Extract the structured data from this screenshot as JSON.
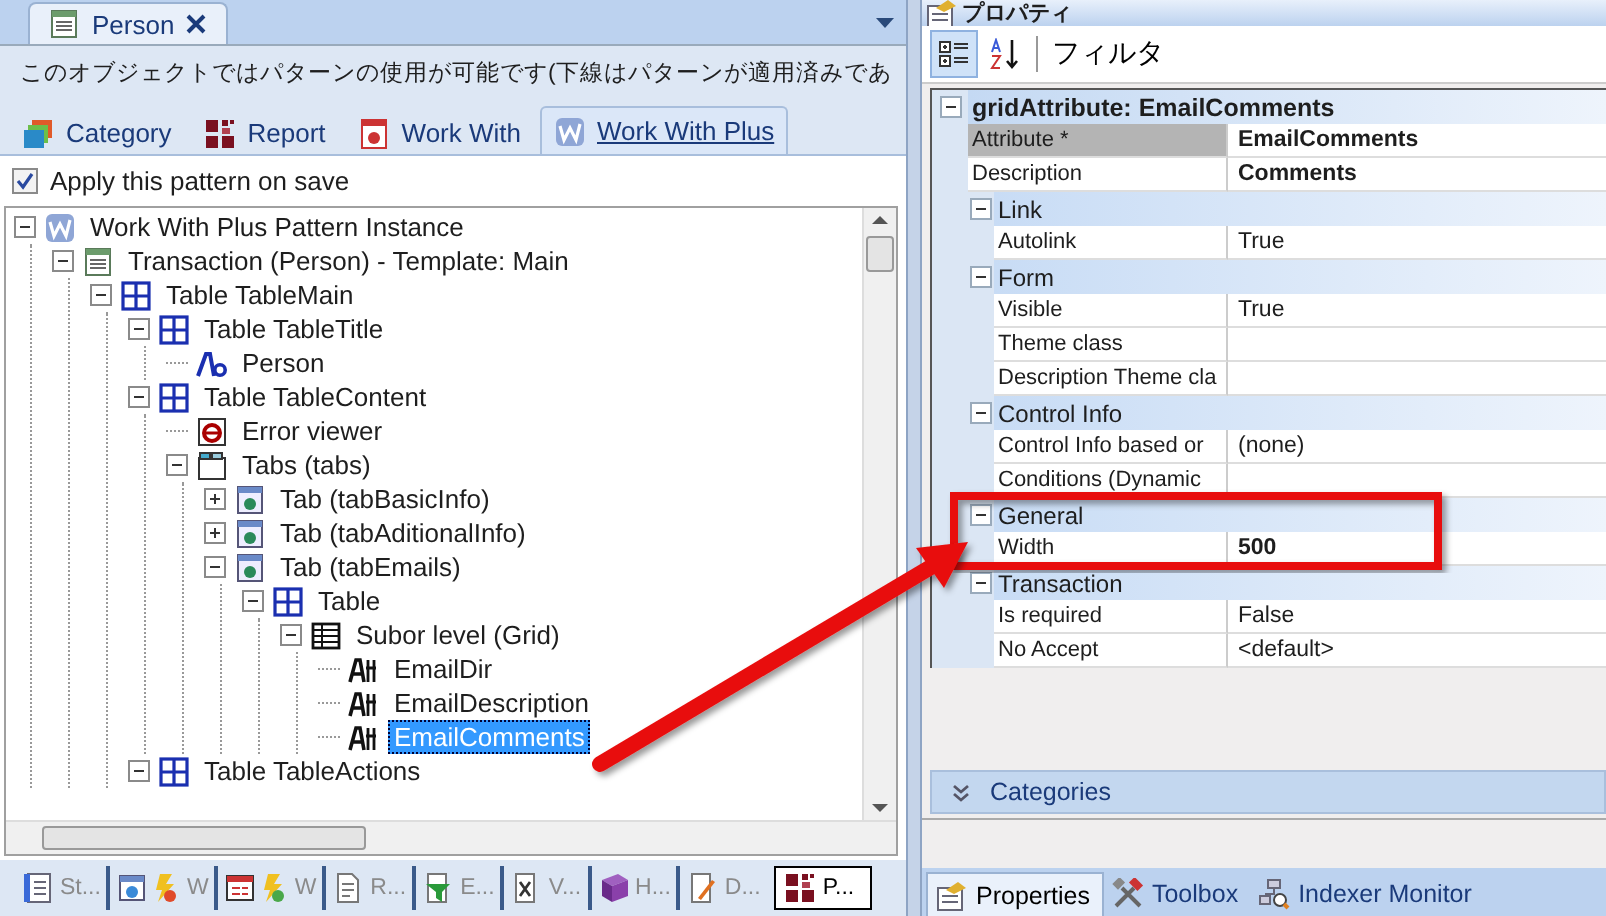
{
  "document_tab": {
    "title": "Person",
    "selected": true
  },
  "notice": "このオブジェクトではパターンの使用が可能です(下線はパターンが適用済みであ",
  "pattern_tabs": [
    {
      "label": "Category",
      "kind": "category",
      "selected": false
    },
    {
      "label": "Report",
      "kind": "report",
      "selected": false
    },
    {
      "label": "Work With",
      "kind": "workwith",
      "selected": false
    },
    {
      "label": "Work With Plus",
      "kind": "workwithplus",
      "selected": true
    }
  ],
  "apply_on_save": {
    "label": "Apply this pattern on save",
    "checked": true
  },
  "tree": [
    {
      "label": "Work With Plus Pattern Instance",
      "kind": "pattern",
      "expanded": true,
      "selected": false,
      "children": [
        {
          "label": "Transaction (Person) - Template: Main",
          "kind": "transaction",
          "expanded": true,
          "selected": false,
          "children": [
            {
              "label": "Table TableMain",
              "kind": "table",
              "expanded": true,
              "selected": false,
              "children": [
                {
                  "label": "Table TableTitle",
                  "kind": "table",
                  "expanded": true,
                  "selected": false,
                  "children": [
                    {
                      "label": "Person",
                      "kind": "textblock",
                      "selected": false
                    }
                  ]
                },
                {
                  "label": "Table TableContent",
                  "kind": "table",
                  "expanded": true,
                  "selected": false,
                  "children": [
                    {
                      "label": "Error viewer",
                      "kind": "error",
                      "selected": false
                    },
                    {
                      "label": "Tabs (tabs)",
                      "kind": "tabs",
                      "expanded": true,
                      "selected": false,
                      "children": [
                        {
                          "label": "Tab (tabBasicInfo)",
                          "kind": "tab",
                          "expanded": false,
                          "selected": false
                        },
                        {
                          "label": "Tab (tabAditionalInfo)",
                          "kind": "tab",
                          "expanded": false,
                          "selected": false
                        },
                        {
                          "label": "Tab (tabEmails)",
                          "kind": "tab",
                          "expanded": true,
                          "selected": false,
                          "children": [
                            {
                              "label": "Table",
                              "kind": "table",
                              "expanded": true,
                              "selected": false,
                              "children": [
                                {
                                  "label": "Subor level (Grid)",
                                  "kind": "grid",
                                  "expanded": true,
                                  "selected": false,
                                  "children": [
                                    {
                                      "label": "EmailDir",
                                      "kind": "attribute",
                                      "selected": false
                                    },
                                    {
                                      "label": "EmailDescription",
                                      "kind": "attribute",
                                      "selected": false
                                    },
                                    {
                                      "label": "EmailComments",
                                      "kind": "attribute",
                                      "selected": true
                                    }
                                  ]
                                }
                              ]
                            }
                          ]
                        }
                      ]
                    }
                  ]
                },
                {
                  "label": "Table TableActions",
                  "kind": "table",
                  "expanded": true,
                  "selected": false
                }
              ]
            }
          ]
        }
      ]
    }
  ],
  "tool_tabs": [
    {
      "label": "St...",
      "kind": "structure",
      "selected": false
    },
    {
      "label": "W",
      "kind": "webform",
      "selected": false
    },
    {
      "label": "W",
      "kind": "winform",
      "selected": false
    },
    {
      "label": "R...",
      "kind": "rules",
      "selected": false
    },
    {
      "label": "E...",
      "kind": "events",
      "selected": false
    },
    {
      "label": "V...",
      "kind": "variables",
      "selected": false
    },
    {
      "label": "H...",
      "kind": "help",
      "selected": false
    },
    {
      "label": "D...",
      "kind": "documentation",
      "selected": false
    },
    {
      "label": "P...",
      "kind": "patterns",
      "selected": true
    }
  ],
  "properties": {
    "title": "プロパティ",
    "view_buttons": [
      {
        "kind": "categorized",
        "selected": true
      },
      {
        "kind": "alphabetical",
        "selected": false
      }
    ],
    "filter_label": "フィルタ",
    "grid": {
      "title": "gridAttribute: EmailComments",
      "expanded": true,
      "rows": [
        {
          "kind": "property",
          "name": "Attribute *",
          "value": "EmailComments",
          "bold": true,
          "selected": true
        },
        {
          "kind": "property",
          "name": "Description",
          "value": "Comments",
          "bold": true,
          "selected": false
        },
        {
          "kind": "group",
          "label": "Link",
          "expanded": true
        },
        {
          "kind": "property",
          "name": "Autolink",
          "value": "True",
          "bold": false,
          "selected": false
        },
        {
          "kind": "group",
          "label": "Form",
          "expanded": true
        },
        {
          "kind": "property",
          "name": "Visible",
          "value": "True",
          "bold": false,
          "selected": false
        },
        {
          "kind": "property",
          "name": "Theme class",
          "bold": false,
          "selected": false
        },
        {
          "kind": "property",
          "name": "Description Theme cla",
          "bold": false,
          "selected": false
        },
        {
          "kind": "group",
          "label": "Control Info",
          "expanded": true
        },
        {
          "kind": "property",
          "name": "Control Info based or",
          "value": "(none)",
          "bold": false,
          "selected": false
        },
        {
          "kind": "property",
          "name": "Conditions (Dynamic",
          "bold": false,
          "selected": false
        },
        {
          "kind": "group",
          "label": "General",
          "expanded": true
        },
        {
          "kind": "property",
          "name": "Width",
          "value": "500",
          "bold": true,
          "selected": false
        },
        {
          "kind": "group",
          "label": "Transaction",
          "expanded": true
        },
        {
          "kind": "property",
          "name": "Is required",
          "value": "False",
          "bold": false,
          "selected": false
        },
        {
          "kind": "property",
          "name": "No Accept",
          "value": "<default>",
          "bold": false,
          "selected": false
        }
      ]
    },
    "categories_label": "Categories",
    "tabs": [
      {
        "label": "Properties",
        "kind": "properties",
        "selected": true
      },
      {
        "label": "Toolbox",
        "kind": "toolbox",
        "selected": false
      },
      {
        "label": "Indexer Monitor",
        "kind": "indexer",
        "selected": false
      }
    ]
  }
}
